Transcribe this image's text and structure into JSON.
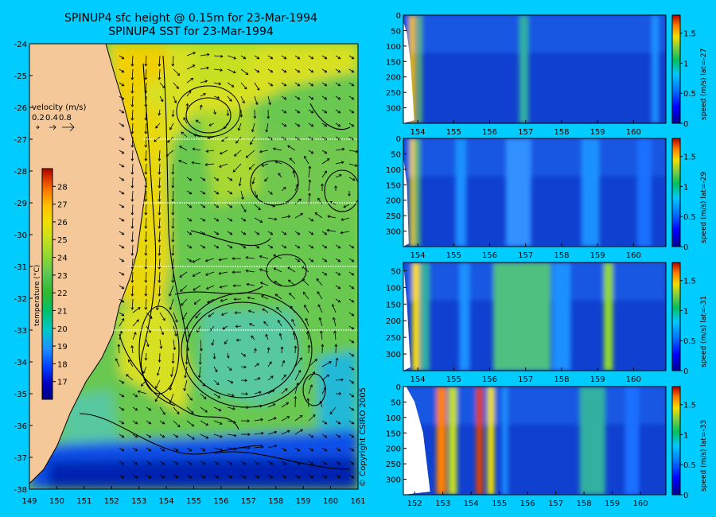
{
  "titles": {
    "line1": "SPINUP4 sfc height @ 0.15m for 23-Mar-1994",
    "line2": "SPINUP4 SST for 23-Mar-1994"
  },
  "copyright": "© Copyright CSIRO 2005",
  "colors": {
    "background": "#00ccff",
    "land": "#f5c89a",
    "contour": "#000000"
  },
  "chart_data": [
    {
      "type": "heatmap",
      "name": "sst-map",
      "x_ticks": [
        "149",
        "150",
        "151",
        "152",
        "153",
        "154",
        "155",
        "156",
        "157",
        "158",
        "159",
        "160",
        "161"
      ],
      "y_ticks": [
        "-24",
        "-25",
        "-26",
        "-27",
        "-28",
        "-29",
        "-30",
        "-31",
        "-32",
        "-33",
        "-34",
        "-35",
        "-36",
        "-37",
        "-38"
      ],
      "xlim": [
        149,
        161
      ],
      "ylim": [
        -38,
        -24
      ],
      "velocity_legend": {
        "label": "velocity (m/s)",
        "values": [
          "0.2",
          "0.4",
          "0.8"
        ]
      },
      "colorbar": {
        "label": "temperature (°C)",
        "ticks": [
          "28",
          "27",
          "26",
          "25",
          "24",
          "23",
          "22",
          "21",
          "20",
          "19",
          "18",
          "17"
        ],
        "range": [
          16,
          29
        ],
        "colors": [
          "#000080",
          "#0000c0",
          "#0040ff",
          "#1e90ff",
          "#00c8c8",
          "#00c070",
          "#30b830",
          "#58c858",
          "#90d830",
          "#c8e020",
          "#f0e000",
          "#ffc000",
          "#ff8000",
          "#e04000",
          "#b00000"
        ]
      },
      "gridlines_at_lat": [
        -27,
        -29,
        -31,
        -33
      ]
    },
    {
      "type": "heatmap",
      "name": "section-lat-27",
      "label": "speed (m/s) lat=-27",
      "x_ticks": [
        "154",
        "155",
        "156",
        "157",
        "158",
        "159",
        "160"
      ],
      "y_ticks": [
        "0",
        "50",
        "100",
        "150",
        "200",
        "250",
        "300"
      ],
      "cbar_ticks": [
        "1.5",
        "1",
        "0.5",
        "0"
      ],
      "cbar_range": [
        0,
        1.8
      ]
    },
    {
      "type": "heatmap",
      "name": "section-lat-29",
      "label": "speed (m/s) lat=-29",
      "x_ticks": [
        "154",
        "155",
        "156",
        "157",
        "158",
        "159",
        "160"
      ],
      "y_ticks": [
        "0",
        "50",
        "100",
        "150",
        "200",
        "250",
        "300"
      ],
      "cbar_ticks": [
        "1.5",
        "1",
        "0.5",
        "0"
      ],
      "cbar_range": [
        0,
        1.8
      ]
    },
    {
      "type": "heatmap",
      "name": "section-lat-31",
      "label": "speed (m/s) lat=-31",
      "x_ticks": [
        "154",
        "155",
        "156",
        "157",
        "158",
        "159",
        "160"
      ],
      "y_ticks": [
        "50",
        "100",
        "150",
        "200",
        "250",
        "300"
      ],
      "cbar_ticks": [
        "1.5",
        "1",
        "0.5",
        "0"
      ],
      "cbar_range": [
        0,
        1.8
      ]
    },
    {
      "type": "heatmap",
      "name": "section-lat-33",
      "label": "speed (m/s) lat=-33",
      "x_ticks": [
        "152",
        "153",
        "154",
        "155",
        "156",
        "157",
        "158",
        "159",
        "160"
      ],
      "y_ticks": [
        "0",
        "50",
        "100",
        "150",
        "200",
        "250",
        "300"
      ],
      "cbar_ticks": [
        "1.5",
        "1",
        "0.5",
        "0"
      ],
      "cbar_range": [
        0,
        1.8
      ]
    }
  ]
}
